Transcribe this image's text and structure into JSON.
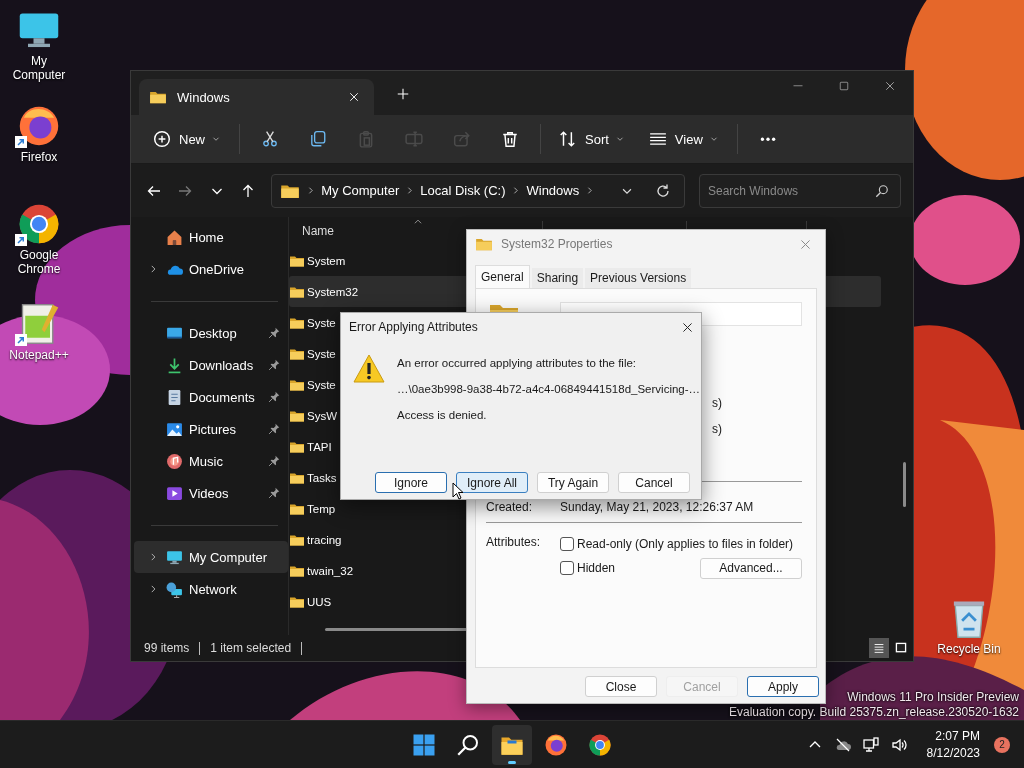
{
  "desktop_icons": [
    {
      "label": "My Computer",
      "kind": "computer",
      "shortcut": false
    },
    {
      "label": "Firefox",
      "kind": "firefox",
      "shortcut": true
    },
    {
      "label": "Google Chrome",
      "kind": "chrome",
      "shortcut": true
    },
    {
      "label": "Notepad++",
      "kind": "notepad",
      "shortcut": true
    },
    {
      "label": "Recycle Bin",
      "kind": "recycle",
      "shortcut": false
    }
  ],
  "explorer": {
    "tabs": [
      {
        "title": "Windows",
        "selected": true
      }
    ],
    "toolbar": [
      {
        "kind": "new",
        "label": "New",
        "disabled": false
      },
      {
        "kind": "separator"
      },
      {
        "kind": "cut",
        "disabled": false
      },
      {
        "kind": "copy",
        "disabled": false
      },
      {
        "kind": "paste",
        "disabled": true
      },
      {
        "kind": "rename",
        "disabled": true
      },
      {
        "kind": "share",
        "disabled": true
      },
      {
        "kind": "delete",
        "disabled": false
      },
      {
        "kind": "separator"
      },
      {
        "kind": "sort",
        "label": "Sort",
        "disabled": false
      },
      {
        "kind": "view",
        "label": "View",
        "disabled": false
      },
      {
        "kind": "separator"
      },
      {
        "kind": "more",
        "disabled": false
      }
    ],
    "nav": [
      {
        "kind": "back",
        "disabled": false
      },
      {
        "kind": "forward",
        "disabled": true
      },
      {
        "kind": "recent",
        "disabled": false
      },
      {
        "kind": "up",
        "disabled": false
      }
    ],
    "breadcrumb": [
      "My Computer",
      "Local Disk (C:)",
      "Windows"
    ],
    "search": {
      "placeholder": "Search Windows"
    },
    "sidebar": [
      [
        {
          "label": "Home",
          "kind": "home",
          "expandable": false,
          "pinned": false,
          "selected": false
        },
        {
          "label": "OneDrive",
          "kind": "onedrive",
          "expandable": true,
          "pinned": false,
          "selected": false
        }
      ],
      [
        {
          "label": "Desktop",
          "kind": "desktop",
          "expandable": false,
          "pinned": true,
          "selected": false
        },
        {
          "label": "Downloads",
          "kind": "downloads",
          "expandable": false,
          "pinned": true,
          "selected": false
        },
        {
          "label": "Documents",
          "kind": "documents",
          "expandable": false,
          "pinned": true,
          "selected": false
        },
        {
          "label": "Pictures",
          "kind": "pictures",
          "expandable": false,
          "pinned": true,
          "selected": false
        },
        {
          "label": "Music",
          "kind": "music",
          "expandable": false,
          "pinned": true,
          "selected": false
        },
        {
          "label": "Videos",
          "kind": "videos",
          "expandable": false,
          "pinned": true,
          "selected": false
        }
      ],
      [
        {
          "label": "My Computer",
          "kind": "computer",
          "expandable": true,
          "pinned": false,
          "selected": true
        },
        {
          "label": "Network",
          "kind": "network",
          "expandable": true,
          "pinned": false,
          "selected": false
        }
      ]
    ],
    "columns": [
      {
        "label": "Name",
        "sorted": true
      }
    ],
    "files": [
      {
        "name": "System",
        "selected": false
      },
      {
        "name": "System32",
        "selected": true
      },
      {
        "name": "Syste",
        "selected": false
      },
      {
        "name": "Syste",
        "selected": false
      },
      {
        "name": "Syste",
        "selected": false
      },
      {
        "name": "SysW",
        "selected": false
      },
      {
        "name": "TAPI",
        "selected": false
      },
      {
        "name": "Tasks",
        "selected": false
      },
      {
        "name": "Temp",
        "selected": false
      },
      {
        "name": "tracing",
        "selected": false
      },
      {
        "name": "twain_32",
        "selected": false
      },
      {
        "name": "UUS",
        "selected": false
      }
    ],
    "status": [
      "99 items",
      "1 item selected"
    ],
    "view_modes": [
      {
        "kind": "details",
        "selected": true
      },
      {
        "kind": "tiles",
        "selected": false
      }
    ]
  },
  "properties": {
    "title": "System32 Properties",
    "tabs": [
      {
        "label": "General",
        "selected": true
      },
      {
        "label": "Sharing",
        "selected": false
      },
      {
        "label": "Previous Versions",
        "selected": false
      }
    ],
    "covered_fragments": [
      "s)",
      "s)"
    ],
    "details": [
      {
        "label": "Created:",
        "value": "Sunday, May 21, 2023, 12:26:37 AM"
      }
    ],
    "attributes_label": "Attributes:",
    "attributes": [
      {
        "label": "Read-only (Only applies to files in folder)",
        "checked": false
      },
      {
        "label": "Hidden",
        "checked": false
      }
    ],
    "advanced_button": "Advanced...",
    "buttons": [
      {
        "label": "Close",
        "disabled": false,
        "default": false
      },
      {
        "label": "Cancel",
        "disabled": true,
        "default": false
      },
      {
        "label": "Apply",
        "disabled": false,
        "default": true
      }
    ]
  },
  "error_dialog": {
    "title": "Error Applying Attributes",
    "lines": [
      "An error occurred applying attributes to the file:",
      "…\\0ae3b998-9a38-4b72-a4c4-06849441518d_Servicing-…",
      "Access is denied."
    ],
    "buttons": [
      {
        "label": "Ignore",
        "default": true,
        "hovered": false
      },
      {
        "label": "Ignore All",
        "default": false,
        "hovered": true
      },
      {
        "label": "Try Again",
        "default": false,
        "hovered": false
      },
      {
        "label": "Cancel",
        "default": false,
        "hovered": false
      }
    ]
  },
  "watermark": [
    "Windows 11 Pro Insider Preview",
    "Evaluation copy. Build 25375.zn_release.230520-1632"
  ],
  "taskbar": {
    "apps": [
      {
        "kind": "start",
        "active": false
      },
      {
        "kind": "search",
        "active": false
      },
      {
        "kind": "explorer",
        "active": true
      },
      {
        "kind": "firefox",
        "active": false
      },
      {
        "kind": "chrome",
        "active": false
      }
    ],
    "tray": [
      {
        "kind": "chevron-up"
      },
      {
        "kind": "cloud-off"
      },
      {
        "kind": "net"
      },
      {
        "kind": "volume"
      }
    ],
    "time": "2:07 PM",
    "date": "8/12/2023",
    "notifications": "2"
  }
}
